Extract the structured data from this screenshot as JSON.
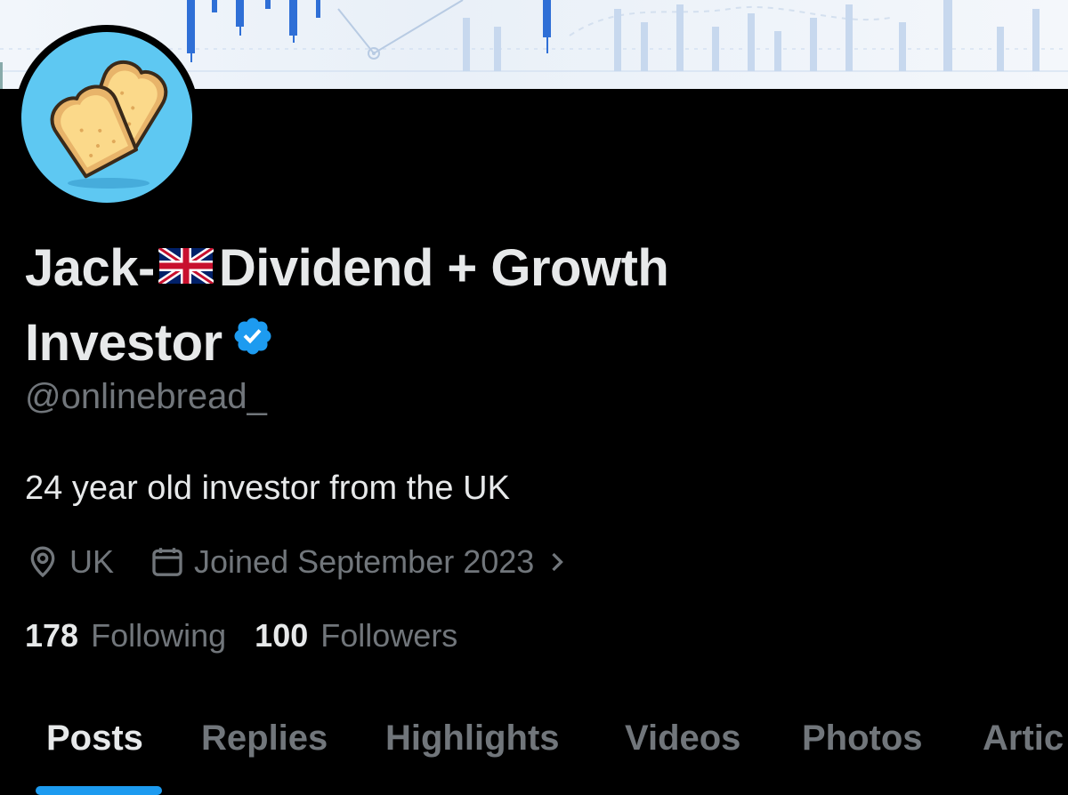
{
  "profile": {
    "name_part1": "Jack-",
    "name_part2": "Dividend + Growth",
    "name_part3": "Investor",
    "handle": "@onlinebread_",
    "bio": "24 year old investor from the UK",
    "location": "UK",
    "joined": "Joined September 2023",
    "following_count": "178",
    "following_label": "Following",
    "followers_count": "100",
    "followers_label": "Followers"
  },
  "icons": {
    "flag": "uk-flag-icon",
    "verified": "verified-badge-icon",
    "location": "location-pin-icon",
    "calendar": "calendar-icon",
    "chevron": "chevron-right-icon",
    "avatar": "toast-bread-avatar"
  },
  "tabs": [
    {
      "label": "Posts",
      "active": true
    },
    {
      "label": "Replies",
      "active": false
    },
    {
      "label": "Highlights",
      "active": false
    },
    {
      "label": "Videos",
      "active": false
    },
    {
      "label": "Photos",
      "active": false
    },
    {
      "label": "Artic",
      "active": false
    }
  ],
  "colors": {
    "accent": "#1d9bf0",
    "background": "#000000",
    "primary_text": "#e7e9ea",
    "secondary_text": "#71767b",
    "avatar_bg": "#5ec8f2"
  }
}
